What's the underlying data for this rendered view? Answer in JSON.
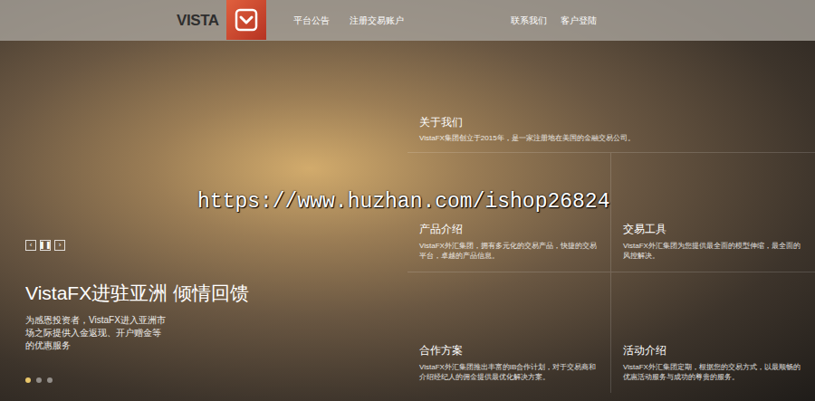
{
  "header": {
    "logo": "VISTA",
    "nav_left": [
      {
        "label": "平台公告"
      },
      {
        "label": "注册交易账户"
      }
    ],
    "nav_right": [
      {
        "label": "联系我们"
      },
      {
        "label": "客户登陆"
      }
    ]
  },
  "slider": {
    "controls": [
      "‹",
      "❚❚",
      "›"
    ],
    "title": "VistaFX进驻亚洲 倾情回馈",
    "subtitle": "为感恩投资者，VistaFX进入亚洲市场之际提供入金返现、开户赠金等的优惠服务",
    "dots": [
      {
        "selected": true
      },
      {
        "selected": false
      },
      {
        "selected": false
      }
    ]
  },
  "about": {
    "title": "关于我们",
    "text": "VistaFX集团创立于2015年，是一家注册地在美国的金融交易公司。"
  },
  "features": [
    {
      "title": "产品介绍",
      "text": "VistaFX外汇集团，拥有多元化的交易产品，快捷的交易平台，卓越的产品信息。"
    },
    {
      "title": "交易工具",
      "text": "VistaFX外汇集团为您提供最全面的模型伸缩，最全面的风控解决。"
    },
    {
      "title": "合作方案",
      "text": "VistaFX外汇集团推出丰富的IB合作计划，对于交易商和介绍经纪人的佣金提供最优化解决方案。"
    },
    {
      "title": "活动介绍",
      "text": "VistaFX外汇集团定期，根据您的交易方式，以最顺畅的优惠活动服务与成功的尊贵的服务。"
    }
  ],
  "watermark": "https://www.huzhan.com/ishop26824"
}
